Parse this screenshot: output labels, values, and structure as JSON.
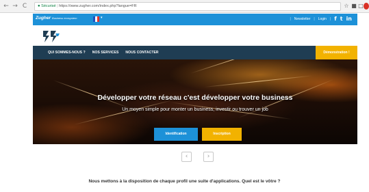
{
  "browser": {
    "back": "←",
    "forward": "→",
    "reload": "C",
    "secure_label": "Sécurisé",
    "url": "https://www.zugher.com/index.php?langue=FR",
    "icons": [
      "star-icon",
      "extension-icon",
      "extension-icon",
      "extension-icon"
    ]
  },
  "topbar": {
    "brand": "Zugher",
    "brand_tagline": "Business ecosystem",
    "language_flag": "fr-flag",
    "newsletter": "Newsletter",
    "login": "Login",
    "social": [
      "f",
      "t",
      "in"
    ],
    "color": "#1d91d8"
  },
  "nav": {
    "items": [
      "QUI SOMMES-NOUS ?",
      "NOS SERVICES",
      "NOUS CONTACTER"
    ],
    "demo_button": "Démonstration !",
    "bg_color": "#1f3d53",
    "accent_color": "#f2b200"
  },
  "hero": {
    "title": "Développer votre réseau c'est développer votre business",
    "subtitle": "Un moyen simple pour monter un business, investir ou trouver un job",
    "identification_button": "Identification",
    "inscription_button": "Inscription"
  },
  "carousel": {
    "prev": "‹",
    "next": "›"
  },
  "tagline": "Nous mettons à la disposition de chaque profil une suite d'applications. Quel est le vôtre ?"
}
